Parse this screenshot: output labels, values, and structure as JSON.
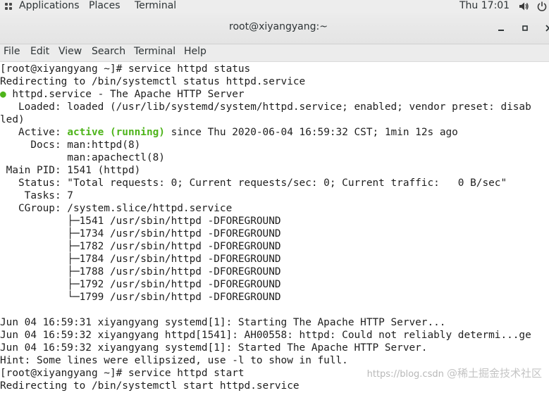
{
  "topbar": {
    "applications": "Applications",
    "places": "Places",
    "terminal": "Terminal",
    "clock": "Thu 17:01"
  },
  "window": {
    "title": "root@xiyangyang:~"
  },
  "menubar": {
    "file": "File",
    "edit": "Edit",
    "view": "View",
    "search": "Search",
    "terminal": "Terminal",
    "help": "Help"
  },
  "terminal": {
    "line_01": "[root@xiyangyang ~]# service httpd status",
    "line_02": "Redirecting to /bin/systemctl status httpd.service",
    "line_03_bullet": "●",
    "line_03_text": " httpd.service - The Apache HTTP Server",
    "line_04": "   Loaded: loaded (/usr/lib/systemd/system/httpd.service; enabled; vendor preset: disab",
    "line_05": "led)",
    "line_06_prefix": "   Active: ",
    "line_06_active": "active (running)",
    "line_06_suffix": " since Thu 2020-06-04 16:59:32 CST; 1min 12s ago",
    "line_07": "     Docs: man:httpd(8)",
    "line_08": "           man:apachectl(8)",
    "line_09": " Main PID: 1541 (httpd)",
    "line_10": "   Status: \"Total requests: 0; Current requests/sec: 0; Current traffic:   0 B/sec\"",
    "line_11": "    Tasks: 7",
    "line_12": "   CGroup: /system.slice/httpd.service",
    "line_13": "           ├─1541 /usr/sbin/httpd -DFOREGROUND",
    "line_14": "           ├─1734 /usr/sbin/httpd -DFOREGROUND",
    "line_15": "           ├─1782 /usr/sbin/httpd -DFOREGROUND",
    "line_16": "           ├─1784 /usr/sbin/httpd -DFOREGROUND",
    "line_17": "           ├─1788 /usr/sbin/httpd -DFOREGROUND",
    "line_18": "           ├─1792 /usr/sbin/httpd -DFOREGROUND",
    "line_19": "           └─1799 /usr/sbin/httpd -DFOREGROUND",
    "line_20": "",
    "line_21": "Jun 04 16:59:31 xiyangyang systemd[1]: Starting The Apache HTTP Server...",
    "line_22": "Jun 04 16:59:32 xiyangyang httpd[1541]: AH00558: httpd: Could not reliably determi...ge",
    "line_23": "Jun 04 16:59:32 xiyangyang systemd[1]: Started The Apache HTTP Server.",
    "line_24": "Hint: Some lines were ellipsized, use -l to show in full.",
    "line_25": "[root@xiyangyang ~]# service httpd start",
    "line_26": "Redirecting to /bin/systemctl start httpd.service"
  },
  "watermark": {
    "url": "https://blog.csdn",
    "brand": "@稀土掘金技术社区"
  },
  "colors": {
    "accent_green": "#4eb41b",
    "terminal_bg": "#ffffff",
    "terminal_fg": "#1e1e1e",
    "chrome_bg": "#ececec"
  },
  "icons": {
    "topbar": [
      "apps-icon",
      "volume-icon",
      "power-icon"
    ],
    "window": [
      "minimize-icon",
      "maximize-icon",
      "close-icon"
    ]
  }
}
